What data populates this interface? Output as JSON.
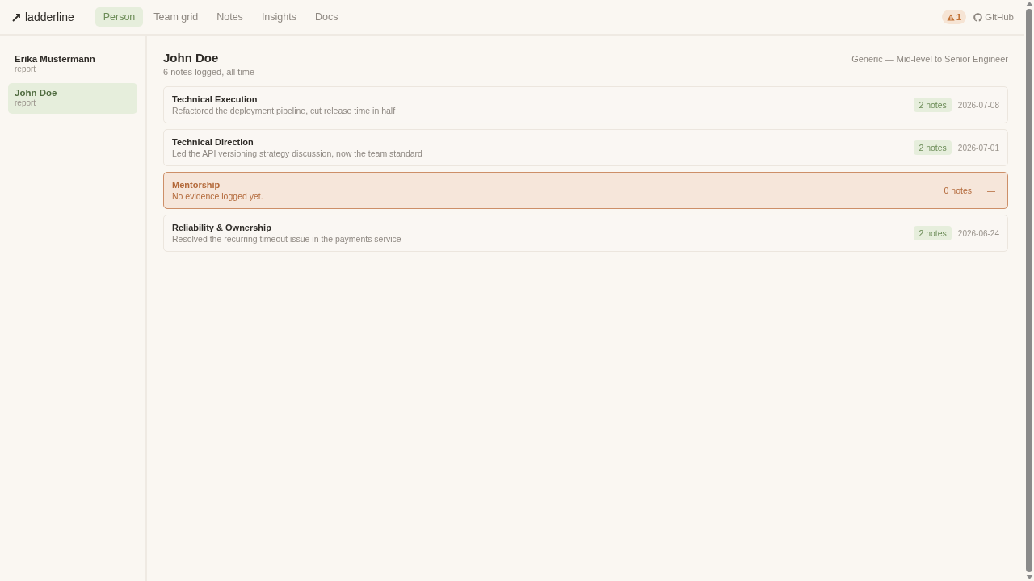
{
  "app": {
    "name": "ladderline"
  },
  "nav": {
    "tabs": [
      {
        "label": "Person",
        "selected": true
      },
      {
        "label": "Team grid",
        "selected": false
      },
      {
        "label": "Notes",
        "selected": false
      },
      {
        "label": "Insights",
        "selected": false
      },
      {
        "label": "Docs",
        "selected": false
      }
    ],
    "alerts": {
      "count": "1"
    },
    "github": {
      "label": "GitHub"
    }
  },
  "sidebar": {
    "people": [
      {
        "name": "Erika Mustermann",
        "role": "report",
        "selected": false
      },
      {
        "name": "John Doe",
        "role": "report",
        "selected": true
      }
    ]
  },
  "person": {
    "name": "John Doe",
    "summary": "6 notes logged, all time",
    "ladder": "Generic — Mid-level to Senior Engineer",
    "areas": [
      {
        "title": "Technical Execution",
        "latest": "Refactored the deployment pipeline, cut release time in half",
        "notes": "2 notes",
        "date": "2026-07-08",
        "flagged": false
      },
      {
        "title": "Technical Direction",
        "latest": "Led the API versioning strategy discussion, now the team standard",
        "notes": "2 notes",
        "date": "2026-07-01",
        "flagged": false
      },
      {
        "title": "Mentorship",
        "latest": "No evidence logged yet.",
        "notes": "0 notes",
        "date": "—",
        "flagged": true
      },
      {
        "title": "Reliability & Ownership",
        "latest": "Resolved the recurring timeout issue in the payments service",
        "notes": "2 notes",
        "date": "2026-06-24",
        "flagged": false
      }
    ]
  }
}
